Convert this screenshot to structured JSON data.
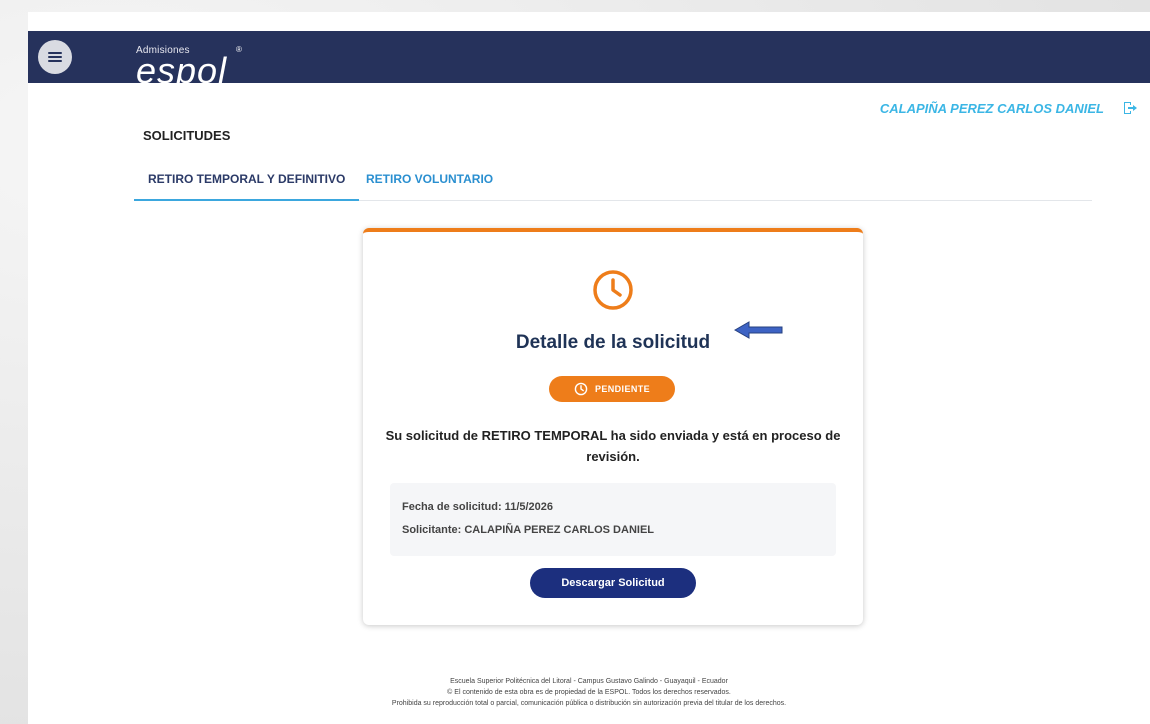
{
  "header": {
    "logo_top": "Admisiones",
    "logo_main": "espol",
    "logo_reg": "®"
  },
  "user": {
    "name": "CALAPIÑA PEREZ CARLOS DANIEL"
  },
  "section": {
    "title": "SOLICITUDES"
  },
  "tabs": [
    {
      "label": "RETIRO TEMPORAL Y DEFINITIVO",
      "active": true
    },
    {
      "label": "RETIRO VOLUNTARIO",
      "active": false
    }
  ],
  "card": {
    "title": "Detalle de la solicitud",
    "status": "PENDIENTE",
    "message": "Su solicitud de RETIRO TEMPORAL ha sido enviada y está en proceso de revisión.",
    "fecha": "Fecha de solicitud: 11/5/2026",
    "solicitante": "Solicitante: CALAPIÑA PEREZ CARLOS DANIEL",
    "download_label": "Descargar Solicitud"
  },
  "footer": {
    "line1": "Escuela Superior Politécnica del Litoral - Campus Gustavo Galindo - Guayaquil - Ecuador",
    "line2": "© El contenido de esta obra es de propiedad de la ESPOL. Todos los derechos reservados.",
    "line3": "Prohibida su reproducción total o parcial, comunicación pública o distribución sin autorización previa del titular de los derechos."
  },
  "colors": {
    "navbar": "#26325c",
    "accent_orange": "#ee7d1a",
    "accent_blue": "#3bb6e5",
    "button_navy": "#1c2f7e"
  },
  "icons": {
    "menu": "hamburger-menu-icon",
    "logout": "logout-icon",
    "clock": "clock-icon",
    "arrow": "left-arrow-icon"
  }
}
